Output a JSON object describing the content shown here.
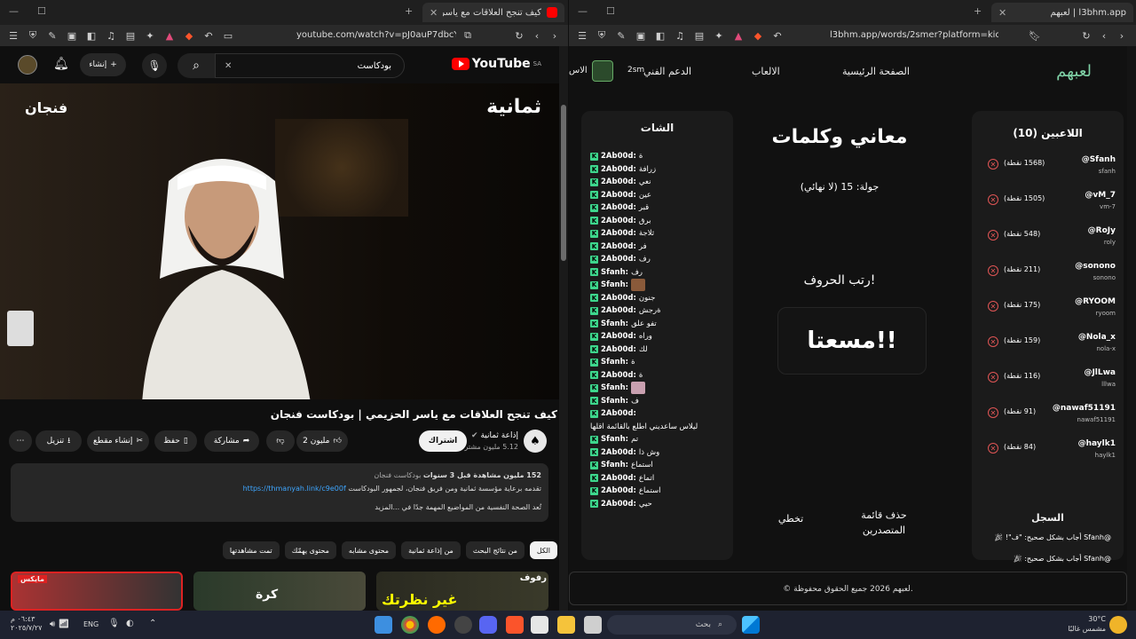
{
  "left_window": {
    "tab_title": "كيف تنجح العلاقات مع ياسر الحز",
    "url": "youtube.com/watch?v=pJ0auP7dbcY",
    "header": {
      "search_value": "بودكاست",
      "create_label": "إنشاء",
      "logo": "YouTube",
      "region": "SA"
    },
    "video": {
      "logo_left": "فنجان",
      "logo_right": "ثمانية",
      "title": "كيف تنجح العلاقات مع ياسر الحزيمي | بودكاست فنجان"
    },
    "channel": {
      "name": "إذاعة ثمانية",
      "subs": "5.12 مليون مشترك",
      "subscribe": "اشتراك"
    },
    "actions": {
      "likes": "2 مليون",
      "share": "مشاركة",
      "save": "حفظ",
      "clip": "إنشاء مقطع",
      "download": "تنزيل"
    },
    "description": {
      "stats": "152 مليون مشاهدة  قبل 3 سنوات",
      "tag": "بودكاست فنجان",
      "line1": "تقدمه برعاية مؤسسة ثمانية ومن فريق فنجان، لجمهور البودكاست",
      "link": "https://thmanyah.link/c9e00f",
      "line2": "تُعد الصحة النفسية من المواضيع المهمة جدًا في ...المزيد"
    },
    "chips": [
      "الكل",
      "من نتائج البحث",
      "من إذاعة ثمانية",
      "محتوى مشابه",
      "محتوى يهمّك",
      "تمت مشاهدتها"
    ],
    "thumbs": [
      "رفوف",
      "غير نظرتك",
      "كرة",
      "مايكس"
    ]
  },
  "right_window": {
    "tab_title": "لعبهم | l3bhm.app",
    "url": "l3bhm.app/words/2smer?platform=kick",
    "nav": {
      "logo": "لعبهم",
      "home": "الصفحة الرئيسية",
      "games": "الالعاب",
      "support": "الدعم الفني",
      "user": "2sm",
      "extra": "الاس"
    },
    "players_title": "اللاعبين (10)",
    "players": [
      {
        "name": "@Sfanh",
        "id": "sfanh",
        "pts": "(1568 نقطة)"
      },
      {
        "name": "@vM_7",
        "id": "vm-7",
        "pts": "(1505 نقطة)"
      },
      {
        "name": "@RoJy",
        "id": "roly",
        "pts": "(548 نقطة)"
      },
      {
        "name": "@sonono",
        "id": "sonono",
        "pts": "(211 نقطة)"
      },
      {
        "name": "@RYOOM",
        "id": "ryoom",
        "pts": "(175 نقطة)"
      },
      {
        "name": "@Nola_x",
        "id": "nola-x",
        "pts": "(159 نقطة)"
      },
      {
        "name": "@JlLwa",
        "id": "lllwa",
        "pts": "(116 نقطة)"
      },
      {
        "name": "@nawaf51191",
        "id": "nawaf51191",
        "pts": "(91 نقطة)"
      },
      {
        "name": "@haylk1",
        "id": "haylk1",
        "pts": "(84 نقطة)"
      }
    ],
    "log_title": "السجل",
    "log": [
      "@Sfanh أجاب بشكل صحيح: \"ف\"!",
      "@Sfanh أجاب بشكل صحيح:"
    ],
    "game": {
      "title": "معاني وكلمات",
      "round": "جولة: 15 (لا نهائي)",
      "prompt": "رتب الحروف!",
      "word": "مسعتا!!",
      "skip": "تخطي",
      "clear": "حذف قائمة المتصدرين"
    },
    "chat_title": "الشات",
    "chat": [
      {
        "u": "2Ab00d:",
        "m": "ة"
      },
      {
        "u": "2Ab00d:",
        "m": "زرافة"
      },
      {
        "u": "2Ab00d:",
        "m": "نعي"
      },
      {
        "u": "2Ab00d:",
        "m": "عين"
      },
      {
        "u": "2Ab00d:",
        "m": "قبر"
      },
      {
        "u": "2Ab00d:",
        "m": "برق"
      },
      {
        "u": "2Ab00d:",
        "m": "ثلاجة"
      },
      {
        "u": "2Ab00d:",
        "m": "فر"
      },
      {
        "u": "2Ab00d:",
        "m": "رف"
      },
      {
        "u": "Sfanh:",
        "m": "رف"
      },
      {
        "u": "Sfanh:",
        "m": "",
        "emote": "#8a5a3a"
      },
      {
        "u": "2Ab00d:",
        "m": "جنون"
      },
      {
        "u": "2Ab00d:",
        "m": "ةرجش"
      },
      {
        "u": "Sfanh:",
        "m": "تفو علق"
      },
      {
        "u": "2Ab00d:",
        "m": "وراه"
      },
      {
        "u": "2Ab00d:",
        "m": "لك"
      },
      {
        "u": "Sfanh:",
        "m": "ة"
      },
      {
        "u": "2Ab00d:",
        "m": "ة"
      },
      {
        "u": "Sfanh:",
        "m": "",
        "emote": "#c9a0b0"
      },
      {
        "u": "Sfanh:",
        "m": "ف"
      },
      {
        "u": "2Ab00d:",
        "m": ""
      },
      {
        "u": "",
        "m": "ليلاس ساعديني اطلع بالقائمة اقلها",
        "plain": true
      },
      {
        "u": "Sfanh:",
        "m": "تم"
      },
      {
        "u": "2Ab00d:",
        "m": "وش ذا"
      },
      {
        "u": "Sfanh:",
        "m": "استماع"
      },
      {
        "u": "2Ab00d:",
        "m": "اتماع"
      },
      {
        "u": "2Ab00d:",
        "m": "استماع"
      },
      {
        "u": "2Ab00d:",
        "m": "حيي"
      }
    ],
    "footer": "© لعبهم 2026 جميع الحقوق محفوظة."
  },
  "taskbar": {
    "search": "بحث",
    "lang": "ENG",
    "time": "٠٦:٤٣ م",
    "date": "٢٠٢٥/٧/٢٧",
    "weather": "30°C",
    "weather_desc": "مشمس غالبًا"
  },
  "colors": {
    "yt_red": "#ff0000",
    "kick_green": "#3dd68c",
    "link_blue": "#3ea6ff",
    "remove_red": "#e05555"
  }
}
